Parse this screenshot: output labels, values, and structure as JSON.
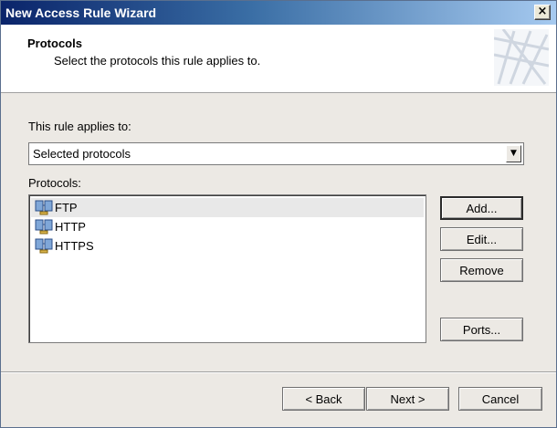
{
  "window": {
    "title": "New Access Rule Wizard",
    "close_label": "×"
  },
  "header": {
    "title": "Protocols",
    "subtitle": "Select the protocols this rule applies to."
  },
  "applies": {
    "label": "This rule applies to:",
    "selected": "Selected protocols"
  },
  "protocols": {
    "label": "Protocols:",
    "items": [
      {
        "label": "FTP",
        "icon": "protocol-icon",
        "selected": true
      },
      {
        "label": "HTTP",
        "icon": "protocol-icon",
        "selected": false
      },
      {
        "label": "HTTPS",
        "icon": "protocol-icon",
        "selected": false
      }
    ]
  },
  "side_buttons": {
    "add": "Add...",
    "edit": "Edit...",
    "remove": "Remove",
    "ports": "Ports..."
  },
  "footer": {
    "back": "< Back",
    "next": "Next >",
    "cancel": "Cancel"
  }
}
